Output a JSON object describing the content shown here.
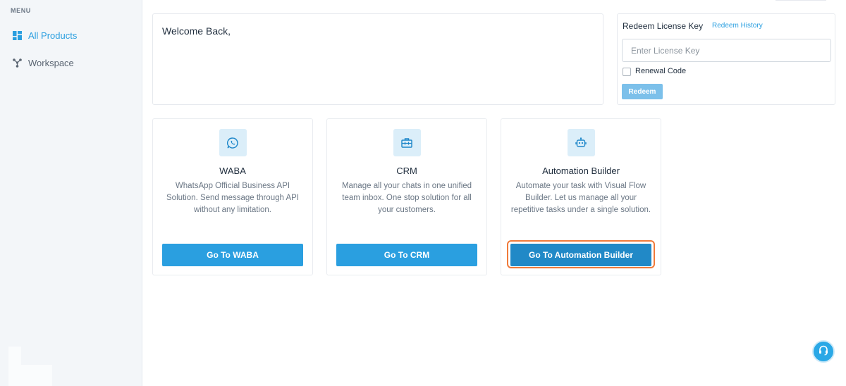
{
  "sidebar": {
    "heading": "MENU",
    "items": [
      {
        "label": "All Products",
        "icon": "grid-icon",
        "active": true
      },
      {
        "label": "Workspace",
        "icon": "workspace-nodes-icon",
        "active": false
      }
    ]
  },
  "welcome": {
    "text": "Welcome Back,"
  },
  "redeem": {
    "title": "Redeem License Key",
    "history_link": "Redeem History",
    "input_placeholder": "Enter License Key",
    "input_value": "",
    "checkbox_label": "Renewal Code",
    "checkbox_checked": false,
    "button_label": "Redeem"
  },
  "products": [
    {
      "title": "WABA",
      "icon": "whatsapp-icon",
      "description": "WhatsApp Official Business API Solution. Send message through API without any limitation.",
      "button": "Go To WABA"
    },
    {
      "title": "CRM",
      "icon": "briefcase-icon",
      "description": "Manage all your chats in one unified team inbox. One stop solution for all your customers.",
      "button": "Go To CRM"
    },
    {
      "title": "Automation Builder",
      "icon": "robot-icon",
      "description": "Automate your task with Visual Flow Builder. Let us manage all your repetitive tasks under a single solution.",
      "button": "Go To Automation Builder"
    }
  ],
  "support": {
    "icon": "headset-icon"
  },
  "colors": {
    "accent": "#2a9fe0",
    "focus_outline": "#f07a3a",
    "sidebar_bg": "#f3f6f9"
  }
}
